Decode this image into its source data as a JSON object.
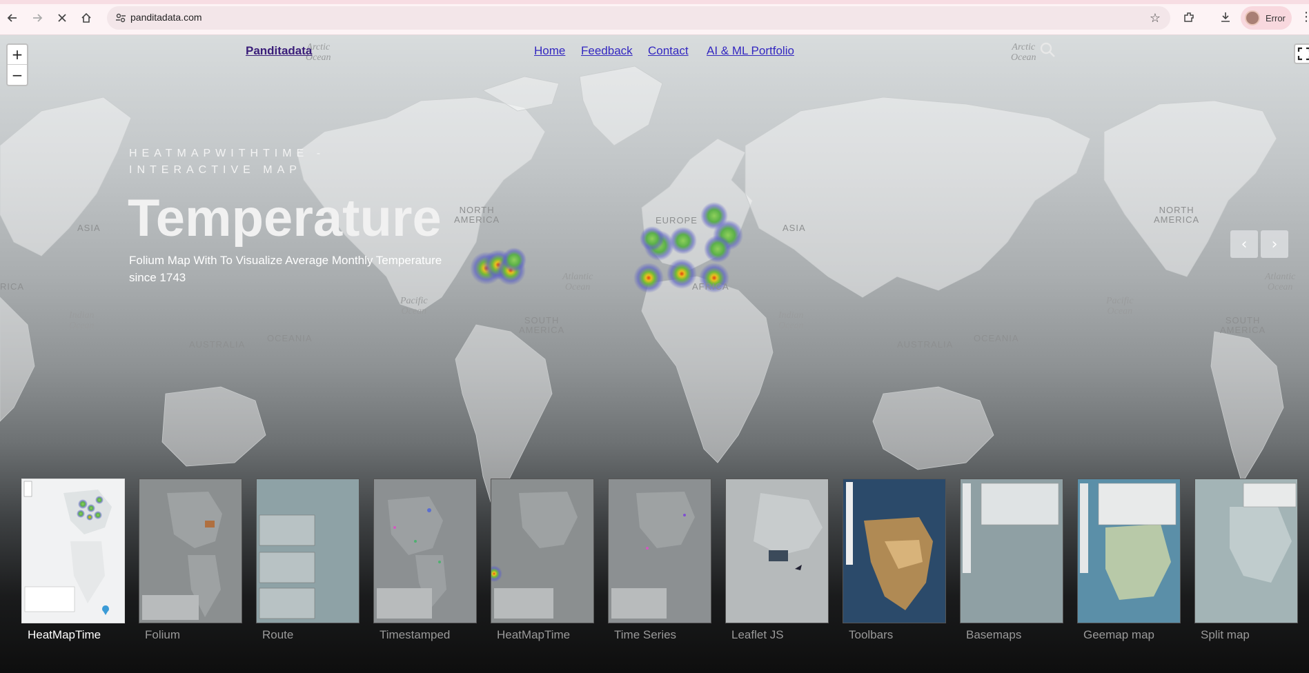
{
  "browser": {
    "url": "panditadata.com",
    "profile_label": "Error"
  },
  "nav": {
    "brand": "Panditadata",
    "links": [
      "Home",
      "Feedback",
      "Contact",
      "AI & ML Portfolio"
    ]
  },
  "hero": {
    "eyebrow": "HEATMAPWITHTIME - INTERACTIVE MAP",
    "title": "Temperature",
    "subtitle": "Folium Map With To Visualize Average Monthly Temperature since 1743"
  },
  "map_labels": {
    "continents": [
      "NORTH AMERICA",
      "EUROPE",
      "ASIA",
      "AFRICA",
      "SOUTH AMERICA",
      "AUSTRALIA",
      "OCEANIA",
      "ASIA",
      "NORTH AMERICA",
      "SOUTH AMERICA",
      "AUSTRALIA",
      "OCEANIA",
      "RICA"
    ],
    "oceans": [
      "Arctic Ocean",
      "Atlantic Ocean",
      "Pacific Ocean",
      "Indian Ocean",
      "Indian Ocean",
      "Arctic Ocean",
      "Pacific Ocean",
      "Atlantic Ocean"
    ]
  },
  "zoom": {
    "in": "+",
    "out": "−"
  },
  "carousel": {
    "prev": "‹",
    "next": "›",
    "items": [
      "HeatMapTime",
      "Folium",
      "Route",
      "Timestamped",
      "HeatMapTime",
      "Time Series",
      "Leaflet JS",
      "Toolbars",
      "Basemaps",
      "Geemap map",
      "Split map"
    ],
    "active_index": 0
  },
  "colors": {
    "brand": "#3a1d79",
    "link": "#3327c0",
    "heat_core": "#e04010",
    "heat_mid": "#6fb93a",
    "heat_outer": "#5d63c4"
  }
}
